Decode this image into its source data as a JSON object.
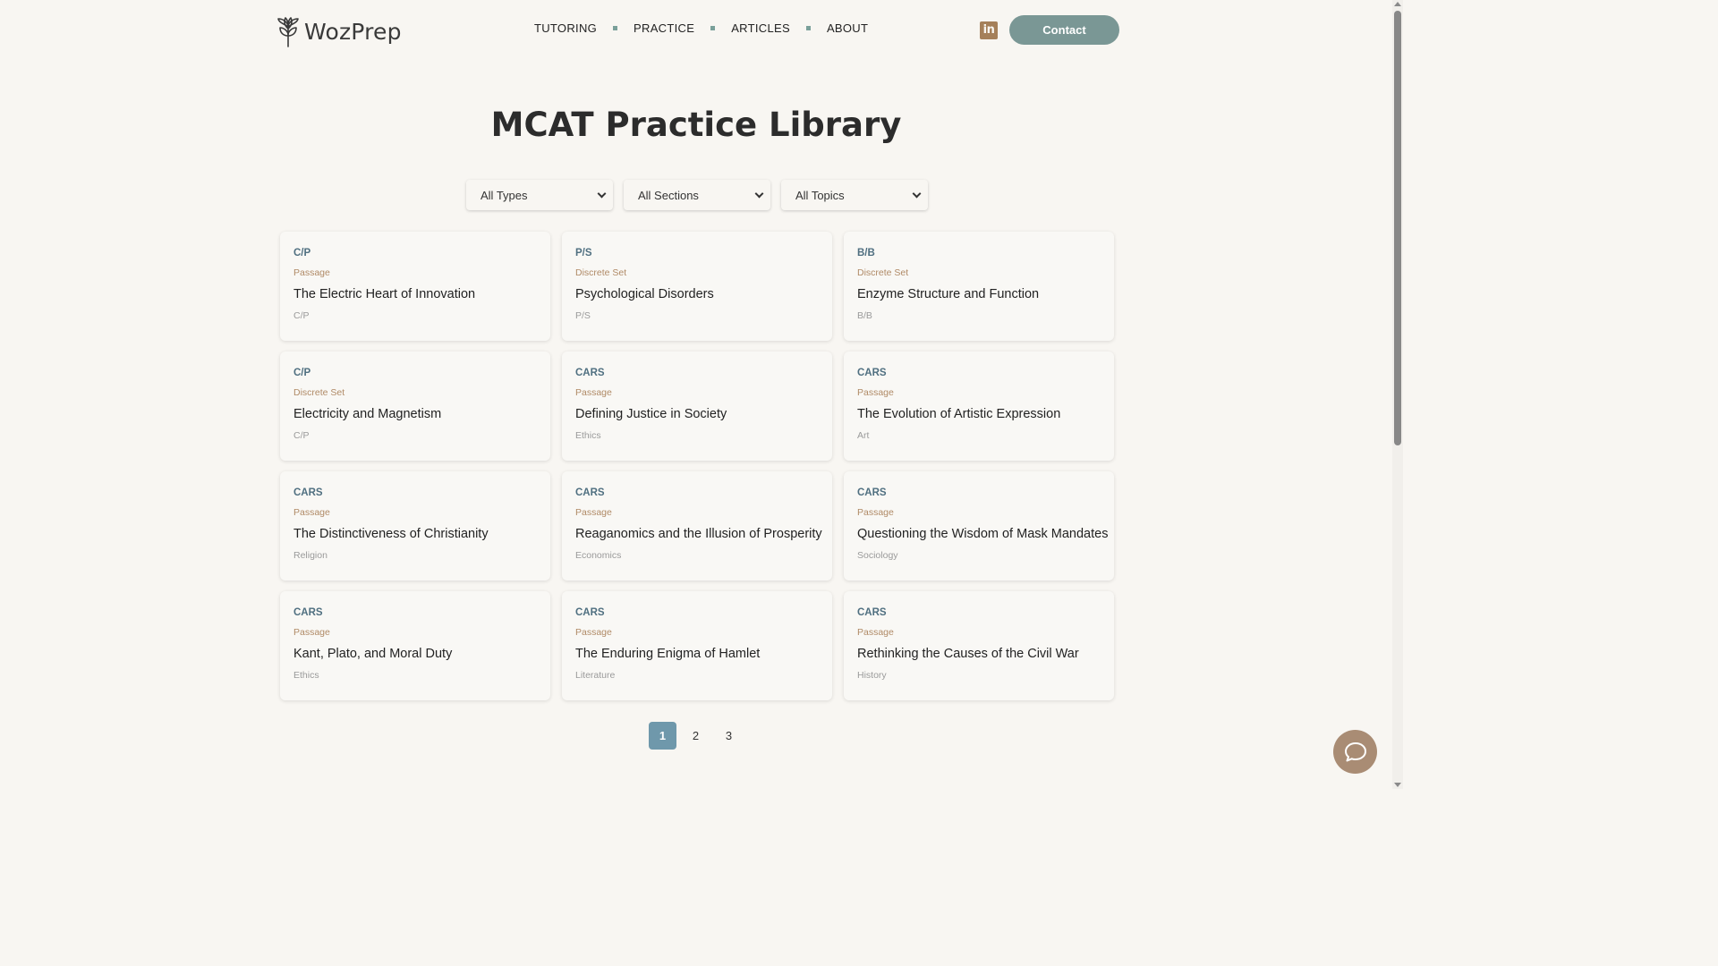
{
  "header": {
    "logo_text": "WozPrep",
    "nav": [
      "TUTORING",
      "PRACTICE",
      "ARTICLES",
      "ABOUT"
    ],
    "linkedin_label": "in",
    "contact_label": "Contact"
  },
  "page_title": "MCAT Practice Library",
  "filters": {
    "types": "All Types",
    "sections": "All Sections",
    "topics": "All Topics"
  },
  "cards": [
    {
      "section": "C/P",
      "type": "Passage",
      "title": "The Electric Heart of Innovation",
      "topic": "C/P"
    },
    {
      "section": "P/S",
      "type": "Discrete Set",
      "title": "Psychological Disorders",
      "topic": "P/S"
    },
    {
      "section": "B/B",
      "type": "Discrete Set",
      "title": "Enzyme Structure and Function",
      "topic": "B/B"
    },
    {
      "section": "C/P",
      "type": "Discrete Set",
      "title": "Electricity and Magnetism",
      "topic": "C/P"
    },
    {
      "section": "CARS",
      "type": "Passage",
      "title": "Defining Justice in Society",
      "topic": "Ethics"
    },
    {
      "section": "CARS",
      "type": "Passage",
      "title": "The Evolution of Artistic Expression",
      "topic": "Art"
    },
    {
      "section": "CARS",
      "type": "Passage",
      "title": "The Distinctiveness of Christianity",
      "topic": "Religion"
    },
    {
      "section": "CARS",
      "type": "Passage",
      "title": "Reaganomics and the Illusion of Prosperity",
      "topic": "Economics"
    },
    {
      "section": "CARS",
      "type": "Passage",
      "title": "Questioning the Wisdom of Mask Mandates",
      "topic": "Sociology"
    },
    {
      "section": "CARS",
      "type": "Passage",
      "title": "Kant, Plato, and Moral Duty",
      "topic": "Ethics"
    },
    {
      "section": "CARS",
      "type": "Passage",
      "title": "The Enduring Enigma of Hamlet",
      "topic": "Literature"
    },
    {
      "section": "CARS",
      "type": "Passage",
      "title": "Rethinking the Causes of the Civil War",
      "topic": "History"
    }
  ],
  "pagination": [
    "1",
    "2",
    "3"
  ],
  "colors": {
    "accent": "#7a9795",
    "section_text": "#4f6f80",
    "type_text": "#b08a66",
    "active_page": "#6f98ab",
    "chat_button": "#a98c74"
  }
}
